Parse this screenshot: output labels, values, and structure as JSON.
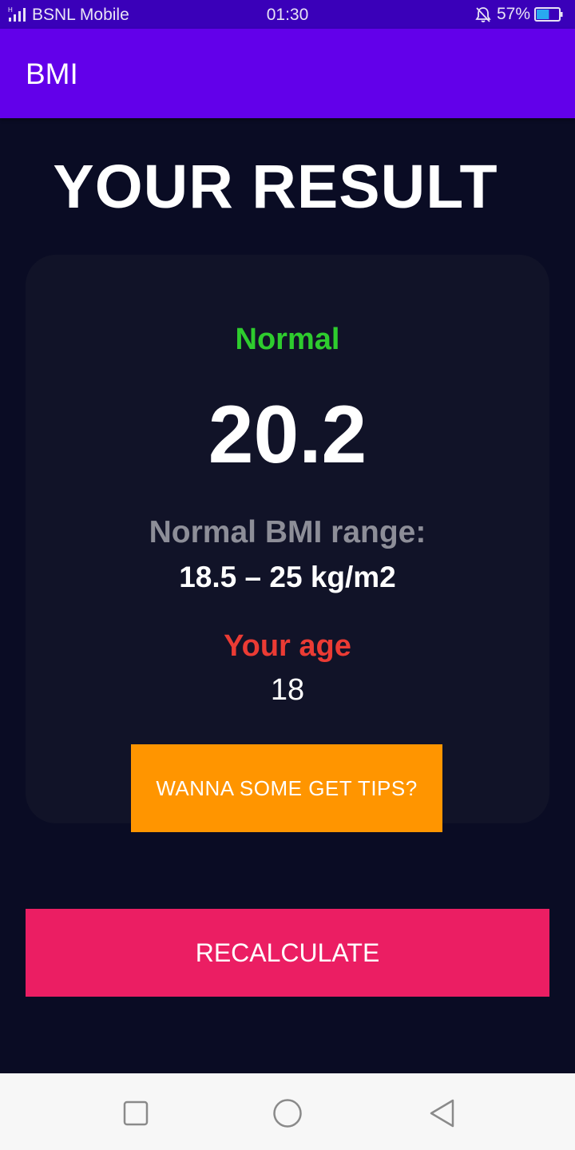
{
  "status_bar": {
    "carrier": "BSNL Mobile",
    "time": "01:30",
    "battery_percent": "57%",
    "battery_level": 0.57,
    "icons": [
      "signal-icon",
      "alarm-off-icon",
      "battery-icon"
    ]
  },
  "app_bar": {
    "title": "BMI"
  },
  "result": {
    "heading": "YOUR RESULT",
    "status": "Normal",
    "bmi": "20.2",
    "range_label": "Normal BMI range:",
    "range_value": "18.5 – 25 kg/m2",
    "age_label": "Your age",
    "age_value": "18"
  },
  "buttons": {
    "tips": "WANNA SOME GET TIPS?",
    "recalculate": "RECALCULATE"
  },
  "nav_bar": {
    "icons": [
      "recents-icon",
      "home-icon",
      "back-icon"
    ]
  },
  "colors": {
    "status_bar": "#3A00B9",
    "app_bar": "#6200EA",
    "background": "#0A0C24",
    "card": "#111328",
    "normal_green": "#2ECC2E",
    "age_red": "#EB3B34",
    "tips_orange": "#FF9500",
    "recalc_pink": "#EB1E63"
  }
}
